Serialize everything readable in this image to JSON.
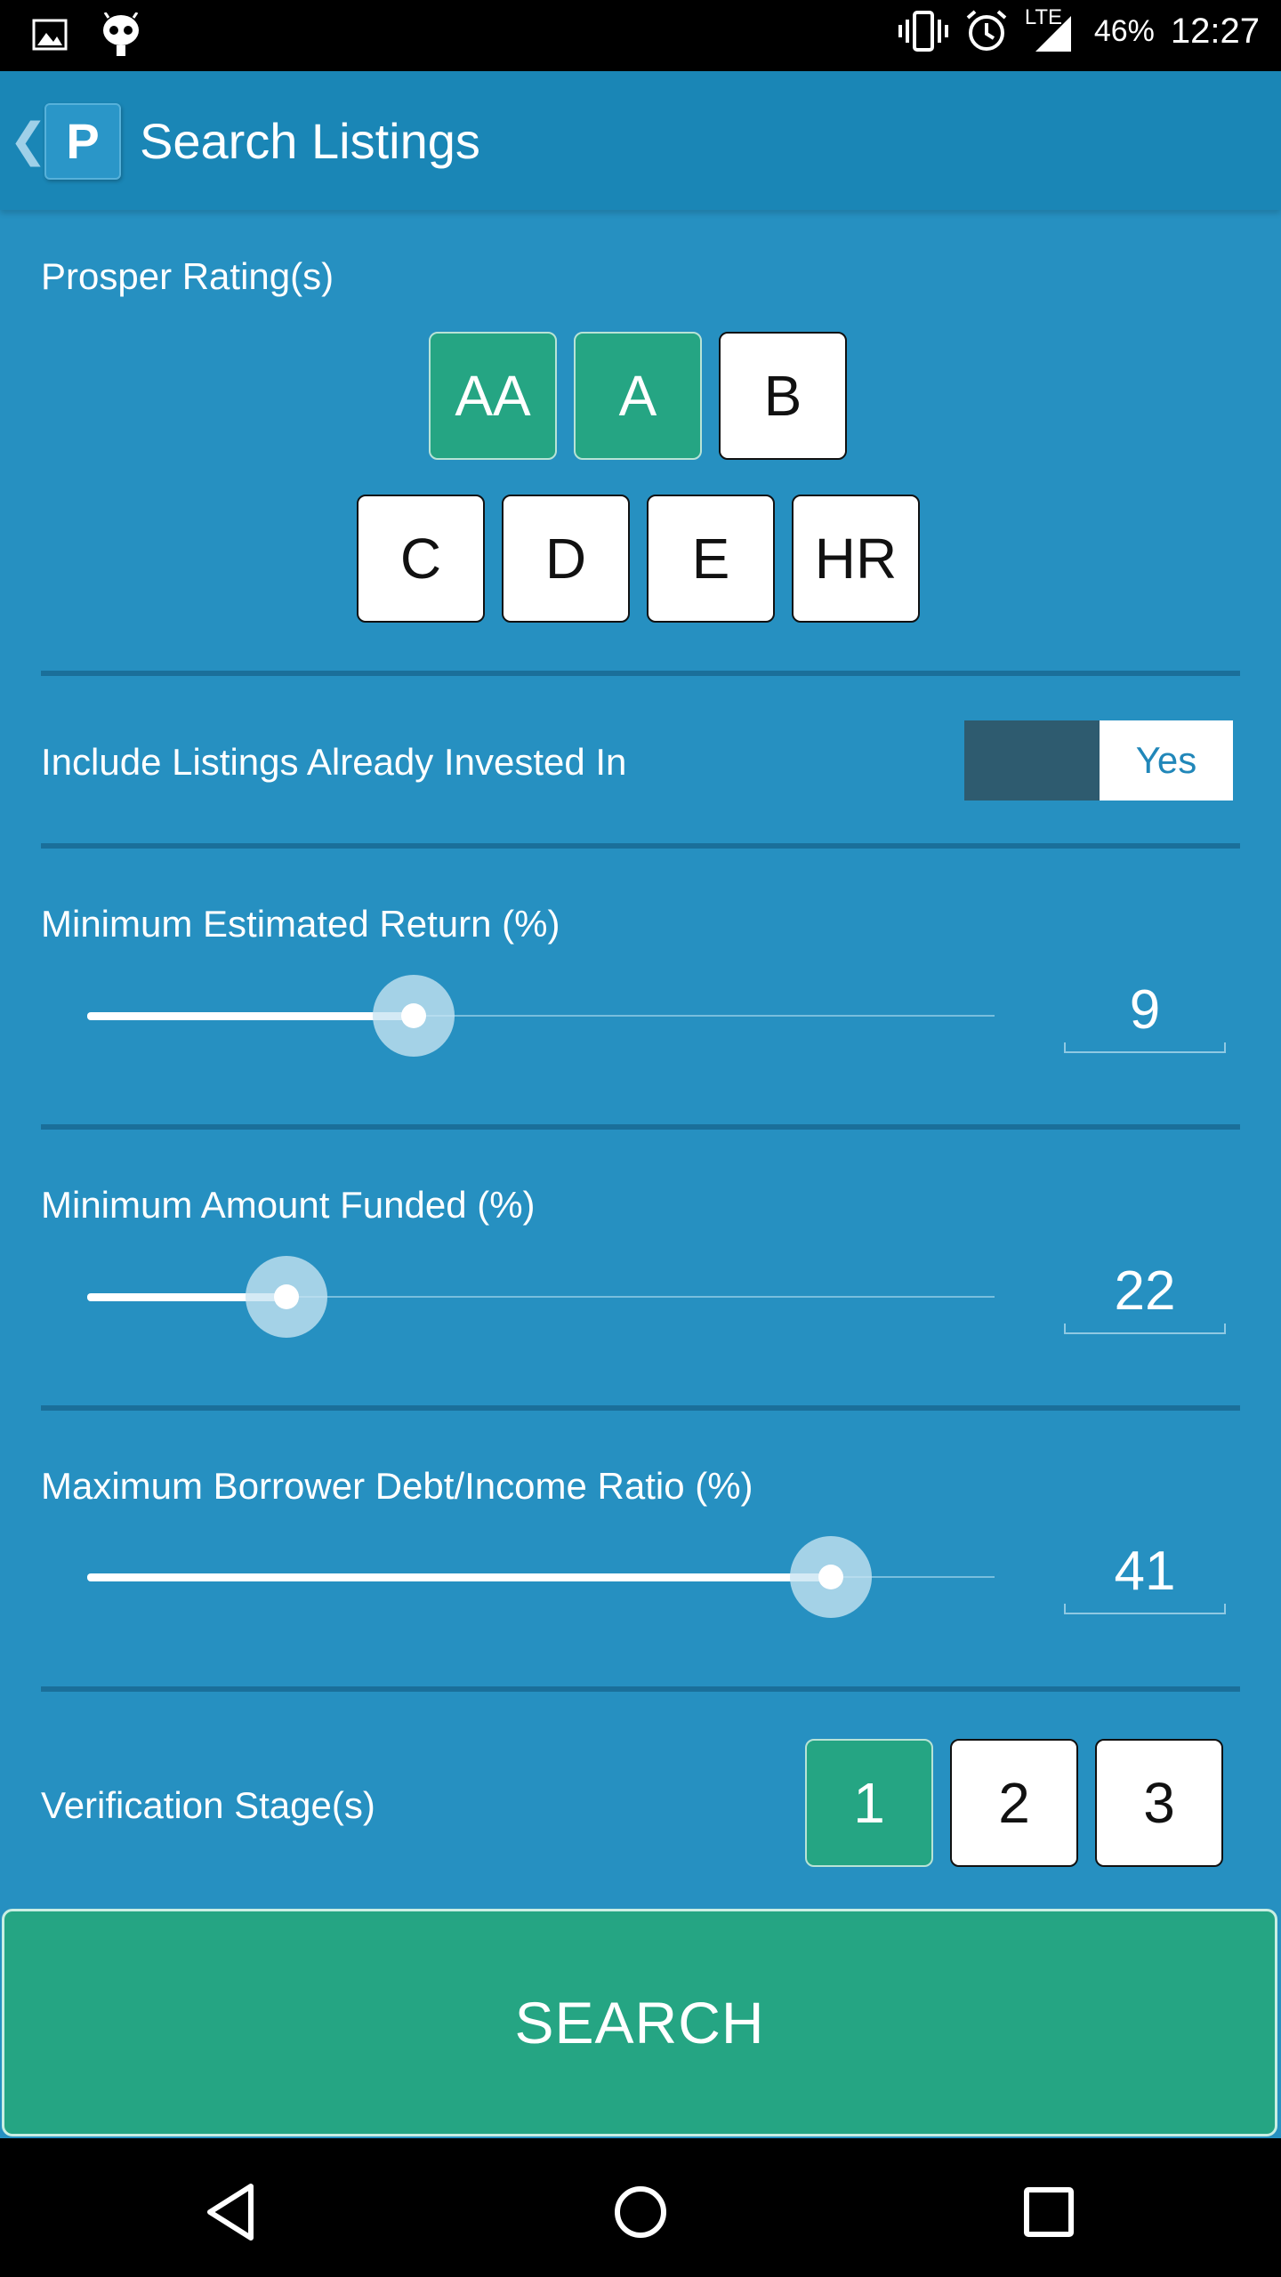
{
  "status_bar": {
    "battery": "46%",
    "time": "12:27",
    "network": "LTE",
    "icons": [
      "image-icon",
      "android-icon",
      "vibrate-icon",
      "alarm-icon",
      "signal-icon"
    ]
  },
  "app_bar": {
    "logo_letter": "P",
    "title": "Search Listings"
  },
  "ratings": {
    "label": "Prosper Rating(s)",
    "grades": [
      {
        "label": "AA",
        "selected": true
      },
      {
        "label": "A",
        "selected": true
      },
      {
        "label": "B",
        "selected": false
      },
      {
        "label": "C",
        "selected": false
      },
      {
        "label": "D",
        "selected": false
      },
      {
        "label": "E",
        "selected": false
      },
      {
        "label": "HR",
        "selected": false
      }
    ]
  },
  "include_invested": {
    "label": "Include Listings Already Invested In",
    "toggle_value": "Yes"
  },
  "sliders": [
    {
      "label": "Minimum Estimated Return (%)",
      "value": "9",
      "fraction": 0.36
    },
    {
      "label": "Minimum Amount Funded (%)",
      "value": "22",
      "fraction": 0.22
    },
    {
      "label": "Maximum Borrower Debt/Income Ratio (%)",
      "value": "41",
      "fraction": 0.82
    }
  ],
  "verification": {
    "label": "Verification Stage(s)",
    "stages": [
      {
        "label": "1",
        "selected": true
      },
      {
        "label": "2",
        "selected": false
      },
      {
        "label": "3",
        "selected": false
      }
    ]
  },
  "search_button": "SEARCH",
  "colors": {
    "background": "#2690c1",
    "app_bar": "#1a86b6",
    "selected": "#25a583",
    "toggle_track": "#2e5b6f"
  }
}
